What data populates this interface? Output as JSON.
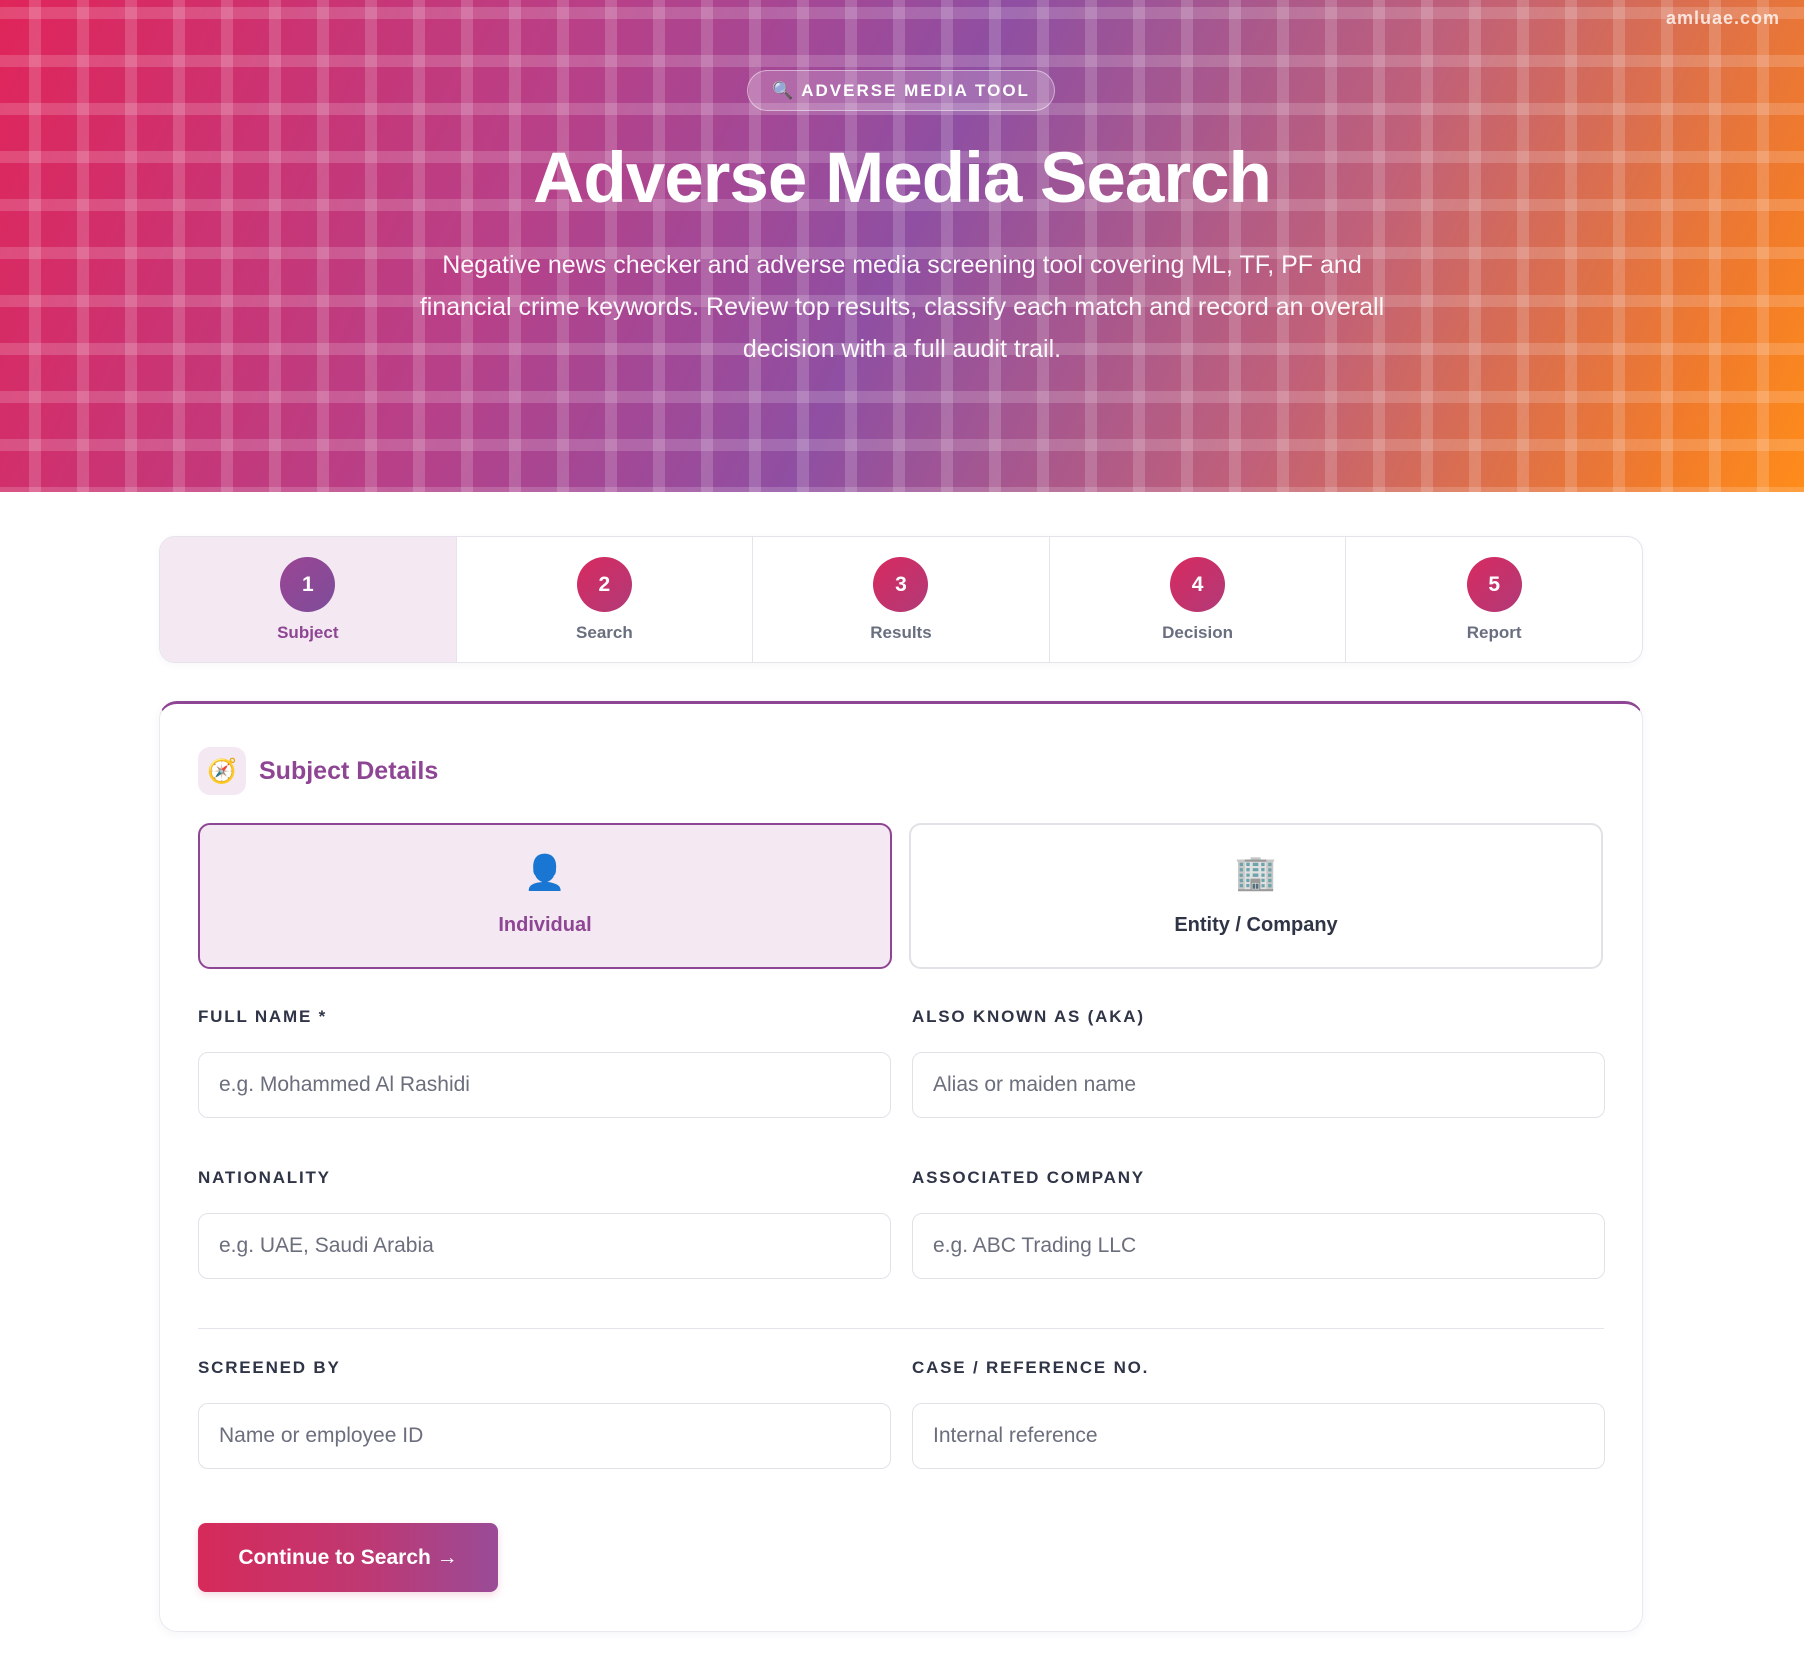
{
  "watermark": "amluae.com",
  "hero": {
    "badge_icon": "magnifier-icon",
    "badge_glyph": "🔍",
    "badge_text": "ADVERSE MEDIA TOOL",
    "title": "Adverse Media Search",
    "description": "Negative news checker and adverse media screening tool covering ML, TF, PF and financial crime keywords. Review top results, classify each match and record an overall decision with a full audit trail."
  },
  "steps": [
    {
      "number": "1",
      "label": "Subject",
      "active": true
    },
    {
      "number": "2",
      "label": "Search",
      "active": false
    },
    {
      "number": "3",
      "label": "Results",
      "active": false
    },
    {
      "number": "4",
      "label": "Decision",
      "active": false
    },
    {
      "number": "5",
      "label": "Report",
      "active": false
    }
  ],
  "card": {
    "icon": "compass-icon",
    "icon_glyph": "🧭",
    "title": "Subject Details",
    "subject_types": [
      {
        "icon": "person-icon",
        "glyph": "👤",
        "label": "Individual",
        "selected": true
      },
      {
        "icon": "office-building-icon",
        "glyph": "🏢",
        "label": "Entity / Company",
        "selected": false
      }
    ],
    "fields": {
      "full_name": {
        "label": "FULL NAME *",
        "placeholder": "e.g. Mohammed Al Rashidi",
        "value": ""
      },
      "aka": {
        "label": "ALSO KNOWN AS (AKA)",
        "placeholder": "Alias or maiden name",
        "value": ""
      },
      "nationality": {
        "label": "NATIONALITY",
        "placeholder": "e.g. UAE, Saudi Arabia",
        "value": ""
      },
      "associated_company": {
        "label": "ASSOCIATED COMPANY",
        "placeholder": "e.g. ABC Trading LLC",
        "value": ""
      },
      "screened_by": {
        "label": "SCREENED BY",
        "placeholder": "Name or employee ID",
        "value": ""
      },
      "case_ref": {
        "label": "CASE / REFERENCE NO.",
        "placeholder": "Internal reference",
        "value": ""
      }
    },
    "submit_label": "Continue to Search →"
  },
  "colors": {
    "accent": "#8e4593",
    "brand_pink": "#d62a5a",
    "brand_orange": "#ff8c1a",
    "active_bg": "#f4e9f3"
  }
}
